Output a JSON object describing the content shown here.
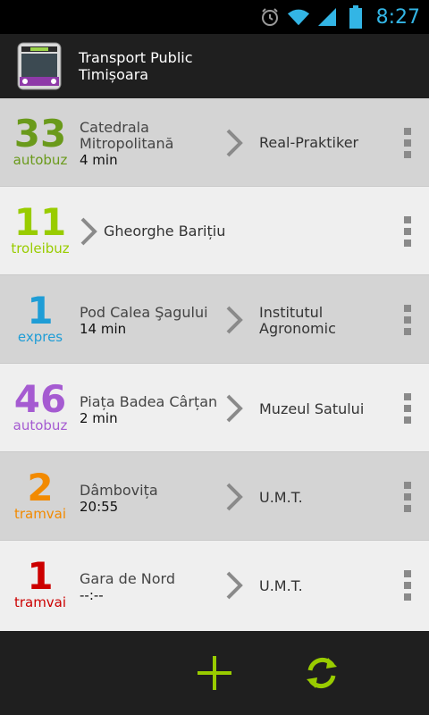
{
  "status_bar": {
    "time": "8:27",
    "color": "#33b5e5"
  },
  "app": {
    "title_line1": "Transport Public",
    "title_line2": "Timișoara"
  },
  "rows": [
    {
      "line": "33",
      "type": "autobuz",
      "color": "#6a9a1b",
      "stop": "Catedrala Mitropolitană",
      "time": "4 min",
      "destination": "Real-Praktiker"
    },
    {
      "line": "11",
      "type": "troleibuz",
      "color": "#99cc00",
      "stop": "Gheorghe Barițiu",
      "time": "",
      "destination": ""
    },
    {
      "line": "1",
      "type": "expres",
      "color": "#1f9dd6",
      "stop": "Pod Calea Şagului",
      "time": "14 min",
      "destination": "Institutul Agronomic"
    },
    {
      "line": "46",
      "type": "autobuz",
      "color": "#a55bd1",
      "stop": "Piața Badea Cârțan",
      "time": "2 min",
      "destination": "Muzeul Satului"
    },
    {
      "line": "2",
      "type": "tramvai",
      "color": "#f28a00",
      "stop": "Dâmbovița",
      "time": "20:55",
      "destination": "U.M.T."
    },
    {
      "line": "1",
      "type": "tramvai",
      "color": "#cc0000",
      "stop": "Gara de Nord",
      "time": "--:--",
      "destination": "U.M.T."
    }
  ],
  "bottom_bar": {
    "add_icon": "plus-icon",
    "refresh_icon": "refresh-icon",
    "accent": "#99cc00"
  }
}
